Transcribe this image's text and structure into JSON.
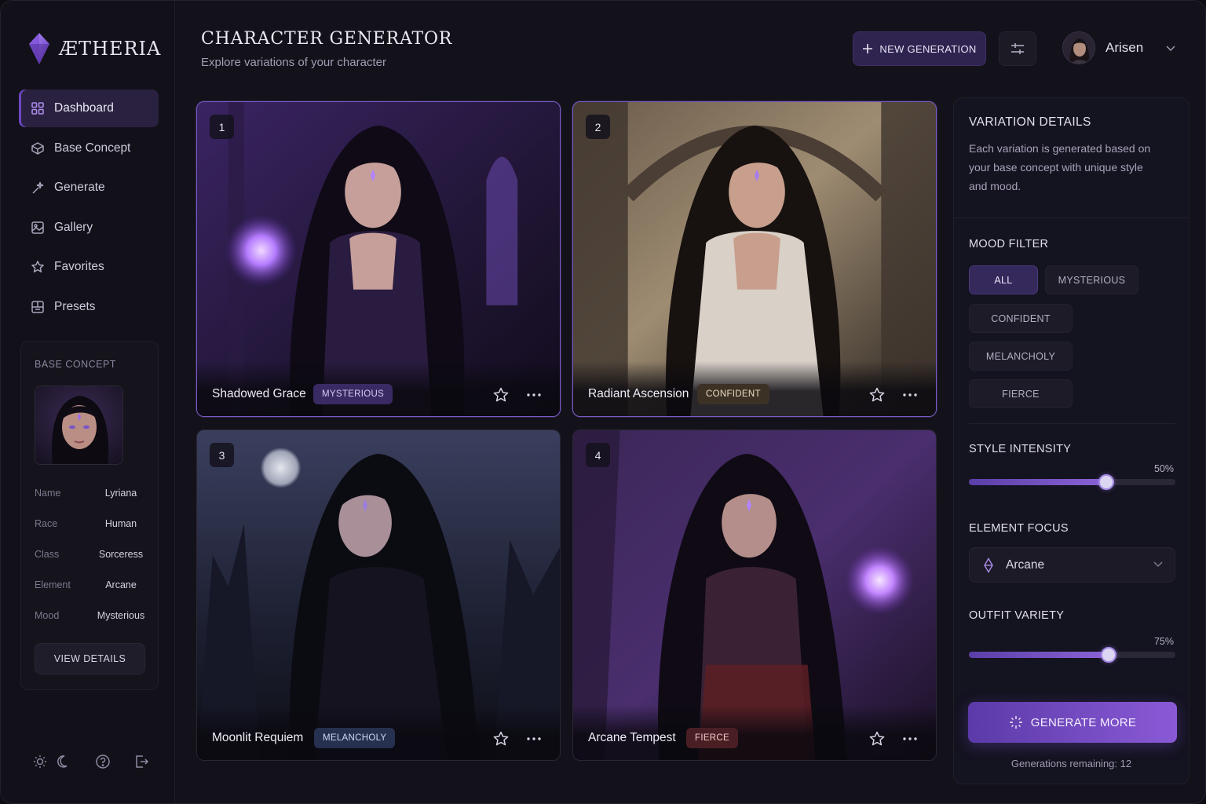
{
  "app": {
    "name": "ÆTHERIA"
  },
  "header": {
    "title": "CHARACTER GENERATOR",
    "subtitle": "Explore variations of your character",
    "new_generation_label": "NEW GENERATION",
    "user_name": "Arisen"
  },
  "sidebar": {
    "items": [
      {
        "label": "Dashboard",
        "icon": "grid-icon",
        "active": true
      },
      {
        "label": "Base Concept",
        "icon": "cube-icon"
      },
      {
        "label": "Generate",
        "icon": "sparkle-wand-icon"
      },
      {
        "label": "Gallery",
        "icon": "image-icon"
      },
      {
        "label": "Favorites",
        "icon": "star-icon"
      },
      {
        "label": "Presets",
        "icon": "presets-icon"
      }
    ],
    "base_concept": {
      "title": "BASE CONCEPT",
      "rows": [
        {
          "key": "Name",
          "value": "Lyriana"
        },
        {
          "key": "Race",
          "value": "Human"
        },
        {
          "key": "Class",
          "value": "Sorceress"
        },
        {
          "key": "Element",
          "value": "Arcane"
        },
        {
          "key": "Mood",
          "value": "Mysterious"
        }
      ],
      "view_details_label": "VIEW DETAILS"
    },
    "bottom_icons": [
      "sun-icon",
      "moon-icon",
      "help-icon",
      "logout-icon"
    ]
  },
  "variations": [
    {
      "number": "1",
      "name": "Shadowed Grace",
      "tag": "MYSTERIOUS",
      "selected": true
    },
    {
      "number": "2",
      "name": "Radiant Ascension",
      "tag": "CONFIDENT",
      "selected": true
    },
    {
      "number": "3",
      "name": "Moonlit Requiem",
      "tag": "MELANCHOLY",
      "selected": false
    },
    {
      "number": "4",
      "name": "Arcane Tempest",
      "tag": "FIERCE",
      "selected": false
    }
  ],
  "panel": {
    "details_title": "VARIATION DETAILS",
    "details_desc": "Each variation is generated based on your base concept with unique style and mood.",
    "mood_filter_title": "MOOD FILTER",
    "moods": [
      "ALL",
      "MYSTERIOUS",
      "CONFIDENT",
      "MELANCHOLY",
      "FIERCE"
    ],
    "active_mood": "ALL",
    "style_intensity": {
      "title": "STYLE INTENSITY",
      "value": 50,
      "label": "50%"
    },
    "element_focus": {
      "title": "ELEMENT FOCUS",
      "value": "Arcane"
    },
    "outfit_variety": {
      "title": "OUTFIT VARIETY",
      "value": 75,
      "label": "75%"
    },
    "generate_more_label": "GENERATE MORE",
    "remaining_text": "Generations remaining: 12"
  },
  "colors": {
    "accent": "#7b5bc7",
    "background": "#13121a",
    "tag_mysterious": "#3a2a63",
    "tag_confident": "#3c3125",
    "tag_melancholy": "#26304f",
    "tag_fierce": "#4a1f24"
  }
}
